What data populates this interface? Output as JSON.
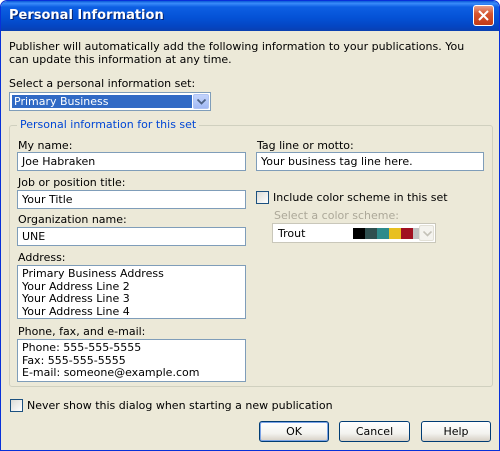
{
  "window": {
    "title": "Personal Information"
  },
  "intro": "Publisher will automatically add the following information to your publications.  You can update this information at any time.",
  "set_select": {
    "label": "Select a personal information set:",
    "value": "Primary Business"
  },
  "group": {
    "legend": "Personal information for this set",
    "name": {
      "label": "My name:",
      "value": "Joe Habraken"
    },
    "job": {
      "label": "Job or position title:",
      "value": "Your Title"
    },
    "organization": {
      "label": "Organization name:",
      "value": "UNE"
    },
    "address": {
      "label": "Address:",
      "value": "Primary Business Address\nYour Address Line 2\nYour Address Line 3\nYour Address Line 4"
    },
    "contact": {
      "label": "Phone, fax, and e-mail:",
      "value": "Phone: 555-555-5555\nFax: 555-555-5555\nE-mail: someone@example.com"
    },
    "tagline": {
      "label": "Tag line or motto:",
      "value": "Your business tag line here."
    },
    "color_scheme": {
      "checkbox_label": "Include color scheme in this set",
      "checked": false,
      "select_label": "Select a color scheme:",
      "value": "Trout",
      "swatches": [
        "#000000",
        "#2f4f4f",
        "#2e8b8b",
        "#e8c020",
        "#a01020",
        "#c0c0c0"
      ]
    }
  },
  "never_show": {
    "label": "Never show this dialog when starting a new publication",
    "checked": false
  },
  "buttons": {
    "ok": "OK",
    "cancel": "Cancel",
    "help": "Help"
  },
  "colors": {
    "titlebar": "#0452d6",
    "face": "#ece9d8",
    "accent": "#316ac5",
    "group_legend": "#0046d5"
  }
}
